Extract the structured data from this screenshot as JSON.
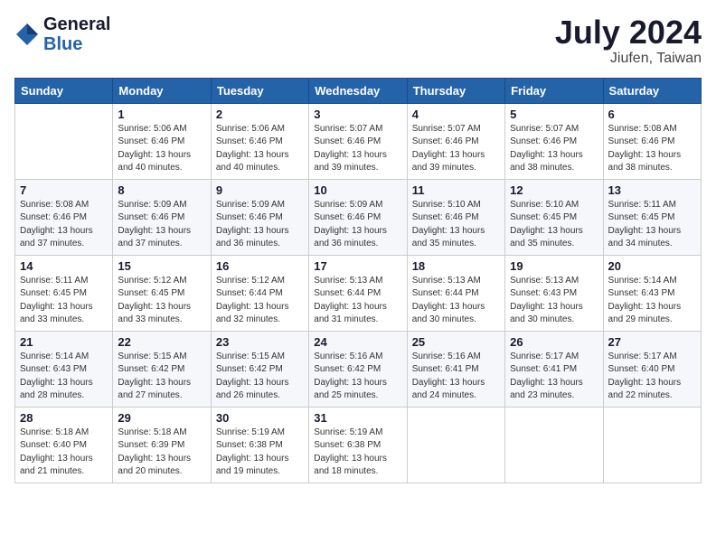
{
  "header": {
    "logo_line1": "General",
    "logo_line2": "Blue",
    "month": "July 2024",
    "location": "Jiufen, Taiwan"
  },
  "weekdays": [
    "Sunday",
    "Monday",
    "Tuesday",
    "Wednesday",
    "Thursday",
    "Friday",
    "Saturday"
  ],
  "weeks": [
    [
      {
        "day": null
      },
      {
        "day": "1",
        "sunrise": "5:06 AM",
        "sunset": "6:46 PM",
        "daylight": "13 hours and 40 minutes."
      },
      {
        "day": "2",
        "sunrise": "5:06 AM",
        "sunset": "6:46 PM",
        "daylight": "13 hours and 40 minutes."
      },
      {
        "day": "3",
        "sunrise": "5:07 AM",
        "sunset": "6:46 PM",
        "daylight": "13 hours and 39 minutes."
      },
      {
        "day": "4",
        "sunrise": "5:07 AM",
        "sunset": "6:46 PM",
        "daylight": "13 hours and 39 minutes."
      },
      {
        "day": "5",
        "sunrise": "5:07 AM",
        "sunset": "6:46 PM",
        "daylight": "13 hours and 38 minutes."
      },
      {
        "day": "6",
        "sunrise": "5:08 AM",
        "sunset": "6:46 PM",
        "daylight": "13 hours and 38 minutes."
      }
    ],
    [
      {
        "day": "7",
        "sunrise": "5:08 AM",
        "sunset": "6:46 PM",
        "daylight": "13 hours and 37 minutes."
      },
      {
        "day": "8",
        "sunrise": "5:09 AM",
        "sunset": "6:46 PM",
        "daylight": "13 hours and 37 minutes."
      },
      {
        "day": "9",
        "sunrise": "5:09 AM",
        "sunset": "6:46 PM",
        "daylight": "13 hours and 36 minutes."
      },
      {
        "day": "10",
        "sunrise": "5:09 AM",
        "sunset": "6:46 PM",
        "daylight": "13 hours and 36 minutes."
      },
      {
        "day": "11",
        "sunrise": "5:10 AM",
        "sunset": "6:46 PM",
        "daylight": "13 hours and 35 minutes."
      },
      {
        "day": "12",
        "sunrise": "5:10 AM",
        "sunset": "6:45 PM",
        "daylight": "13 hours and 35 minutes."
      },
      {
        "day": "13",
        "sunrise": "5:11 AM",
        "sunset": "6:45 PM",
        "daylight": "13 hours and 34 minutes."
      }
    ],
    [
      {
        "day": "14",
        "sunrise": "5:11 AM",
        "sunset": "6:45 PM",
        "daylight": "13 hours and 33 minutes."
      },
      {
        "day": "15",
        "sunrise": "5:12 AM",
        "sunset": "6:45 PM",
        "daylight": "13 hours and 33 minutes."
      },
      {
        "day": "16",
        "sunrise": "5:12 AM",
        "sunset": "6:44 PM",
        "daylight": "13 hours and 32 minutes."
      },
      {
        "day": "17",
        "sunrise": "5:13 AM",
        "sunset": "6:44 PM",
        "daylight": "13 hours and 31 minutes."
      },
      {
        "day": "18",
        "sunrise": "5:13 AM",
        "sunset": "6:44 PM",
        "daylight": "13 hours and 30 minutes."
      },
      {
        "day": "19",
        "sunrise": "5:13 AM",
        "sunset": "6:43 PM",
        "daylight": "13 hours and 30 minutes."
      },
      {
        "day": "20",
        "sunrise": "5:14 AM",
        "sunset": "6:43 PM",
        "daylight": "13 hours and 29 minutes."
      }
    ],
    [
      {
        "day": "21",
        "sunrise": "5:14 AM",
        "sunset": "6:43 PM",
        "daylight": "13 hours and 28 minutes."
      },
      {
        "day": "22",
        "sunrise": "5:15 AM",
        "sunset": "6:42 PM",
        "daylight": "13 hours and 27 minutes."
      },
      {
        "day": "23",
        "sunrise": "5:15 AM",
        "sunset": "6:42 PM",
        "daylight": "13 hours and 26 minutes."
      },
      {
        "day": "24",
        "sunrise": "5:16 AM",
        "sunset": "6:42 PM",
        "daylight": "13 hours and 25 minutes."
      },
      {
        "day": "25",
        "sunrise": "5:16 AM",
        "sunset": "6:41 PM",
        "daylight": "13 hours and 24 minutes."
      },
      {
        "day": "26",
        "sunrise": "5:17 AM",
        "sunset": "6:41 PM",
        "daylight": "13 hours and 23 minutes."
      },
      {
        "day": "27",
        "sunrise": "5:17 AM",
        "sunset": "6:40 PM",
        "daylight": "13 hours and 22 minutes."
      }
    ],
    [
      {
        "day": "28",
        "sunrise": "5:18 AM",
        "sunset": "6:40 PM",
        "daylight": "13 hours and 21 minutes."
      },
      {
        "day": "29",
        "sunrise": "5:18 AM",
        "sunset": "6:39 PM",
        "daylight": "13 hours and 20 minutes."
      },
      {
        "day": "30",
        "sunrise": "5:19 AM",
        "sunset": "6:38 PM",
        "daylight": "13 hours and 19 minutes."
      },
      {
        "day": "31",
        "sunrise": "5:19 AM",
        "sunset": "6:38 PM",
        "daylight": "13 hours and 18 minutes."
      },
      {
        "day": null
      },
      {
        "day": null
      },
      {
        "day": null
      }
    ]
  ]
}
